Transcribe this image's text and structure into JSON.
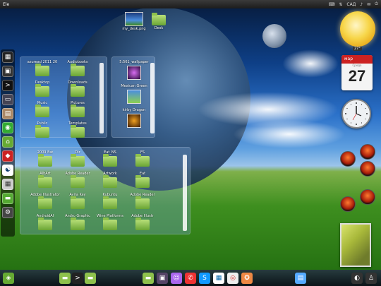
{
  "top_panel": {
    "menu": "Ele",
    "layout": "CAД",
    "status_icons": [
      "keyboard-icon",
      "network-icon",
      "volume-icon",
      "mail-icon",
      "power-icon"
    ]
  },
  "desktop_icons": [
    {
      "label": "my_desk.png",
      "icon": "image-icon"
    },
    {
      "label": "Desk",
      "icon": "folder-icon"
    }
  ],
  "stack_top": {
    "items": [
      {
        "label": "azuread 2011 20",
        "icon": "folder-icon"
      },
      {
        "label": "Audiobooks",
        "icon": "folder-icon"
      },
      {
        "label": "Desktop",
        "icon": "folder-icon"
      },
      {
        "label": "Downloads",
        "icon": "folder-icon"
      },
      {
        "label": "Music",
        "icon": "folder-icon"
      },
      {
        "label": "Pictures",
        "icon": "folder-icon"
      },
      {
        "label": "Public",
        "icon": "folder-icon"
      },
      {
        "label": "Templates",
        "icon": "folder-icon"
      }
    ]
  },
  "stack_images": {
    "items": [
      {
        "label": "5:561_wallpaper",
        "icon": "image-icon"
      },
      {
        "label": "Mexican Green",
        "icon": "image-icon"
      },
      {
        "label": "kirby Dragon",
        "icon": "image-icon"
      }
    ]
  },
  "stack_bottom": {
    "items": [
      {
        "label": "2009 Eat",
        "icon": "folder-icon"
      },
      {
        "label": "Dir",
        "icon": "folder-icon"
      },
      {
        "label": "Eat_NS",
        "icon": "folder-icon"
      },
      {
        "label": "FS",
        "icon": "folder-icon"
      },
      {
        "label": "AlbArt",
        "icon": "folder-icon"
      },
      {
        "label": "Adobe Reader",
        "icon": "folder-icon"
      },
      {
        "label": "Artwork",
        "icon": "folder-icon"
      },
      {
        "label": "Eat",
        "icon": "folder-icon"
      },
      {
        "label": "Adobe Illustrator",
        "icon": "folder-icon"
      },
      {
        "label": "Avira Key",
        "icon": "folder-icon"
      },
      {
        "label": "Kubuntu",
        "icon": "folder-icon"
      },
      {
        "label": "Adobe Reader",
        "icon": "folder-icon"
      },
      {
        "label": "AndroidAI",
        "icon": "folder-icon"
      },
      {
        "label": "Andro Graphic",
        "icon": "folder-icon"
      },
      {
        "label": "Wine Platforms",
        "icon": "folder-icon"
      },
      {
        "label": "Adobe Illustr",
        "icon": "folder-icon"
      }
    ]
  },
  "left_dock": [
    "app-icon",
    "monitor-icon",
    "terminal-icon",
    "screen-icon",
    "files-icon",
    "nvidia-icon",
    "mint-icon",
    "shield-icon",
    "yinyang-icon",
    "calculator-icon",
    "folder-green-icon",
    "gear-icon"
  ],
  "widgets": {
    "weather_temp": "27°",
    "calendar": {
      "month": "мар",
      "weekday": "Среда",
      "day": "27"
    }
  },
  "taskbar_icons": [
    "mint-menu-icon",
    "folder-icon",
    "terminal-icon",
    "folder-icon",
    "folder-icon",
    "photo-icon",
    "pidgin-icon",
    "chat-icon",
    "skype-icon",
    "sheet-icon",
    "chrome-icon",
    "firefox-icon",
    "network-icon",
    "tray-icon",
    "user-icon"
  ],
  "colors": {
    "panel": "#1c1c1c",
    "folder": "#8ec14c",
    "calendar_header": "#cc2222"
  }
}
